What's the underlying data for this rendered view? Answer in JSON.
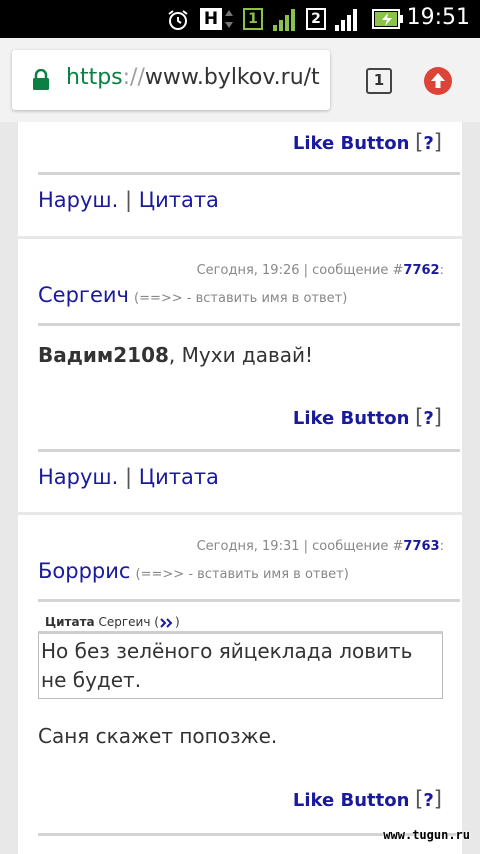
{
  "status_bar": {
    "time": "19:51",
    "network_h": "H",
    "sim1": "1",
    "sim2": "2",
    "icons": [
      "alarm-icon",
      "network-type-icon",
      "sim1-icon",
      "signal-icon",
      "sim2-icon",
      "signal-icon",
      "battery-charging-icon"
    ]
  },
  "browser": {
    "url_scheme": "https",
    "url_sep": "://",
    "url_host": "www.bylkov.ru/t",
    "tab_count": "1",
    "colors": {
      "secure": "#0b8043",
      "update": "#db4437"
    }
  },
  "posts": [
    {
      "like_label": "Like Button",
      "help": "?",
      "report": "Наруш.",
      "quote_link": "Цитата"
    },
    {
      "date": "Сегодня, 19:26 | сообщение #",
      "number": "7762",
      "colon": ":",
      "author": "Сергеич",
      "insert_hint": "(==>> - вставить имя в ответ)",
      "mention": "Вадим2108",
      "text": ", Мухи давай!",
      "like_label": "Like Button",
      "help": "?",
      "report": "Наруш.",
      "quote_link": "Цитата"
    },
    {
      "date": "Сегодня, 19:31 | сообщение #",
      "number": "7763",
      "colon": ":",
      "author": "Борррис",
      "insert_hint": "(==>> - вставить имя в ответ)",
      "quote_label": "Цитата",
      "quote_author": "Сергеич",
      "quote_text": "Но без зелёного яйцеклада ловить не будет.",
      "text": "Саня скажет попозже.",
      "like_label": "Like Button",
      "help": "?"
    }
  ],
  "separator": "|",
  "watermark": "www.tugun.ru"
}
